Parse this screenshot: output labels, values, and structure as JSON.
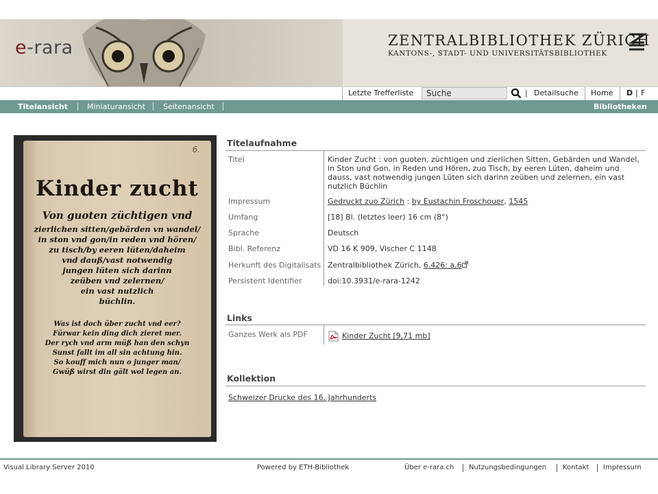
{
  "header": {
    "logo_prefix": "e",
    "logo_rest": "-rara",
    "library_name": "ZENTRALBIBLIOTHEK ZÜRICH",
    "library_subtitle": "KANTONS-, STADT- UND UNIVERSITÄTSBIBLIOTHEK"
  },
  "searchbar": {
    "last_results": "Letzte Trefferliste",
    "search_value": "Suche",
    "advanced": "Detailsuche",
    "home": "Home",
    "lang_de": "D",
    "lang_fr": "F",
    "sep": "|"
  },
  "nav": {
    "tabs": [
      "Titelansicht",
      "Miniaturansicht",
      "Seitenansicht"
    ],
    "right": "Bibliotheken"
  },
  "book": {
    "page_number": "6.",
    "title": "Kinder zucht",
    "lines": [
      "Von guoten züchtigen vnd",
      "zierlichen sitten/gebärden vn wandel/",
      "in ston vnd gon/in reden vnd hören/",
      "zu tisch/by eeren lüten/daheim",
      "vnd dauß/vast notwendig",
      "jungen lüten sich darinn",
      "zeüben vnd zelernen/",
      "ein vast nutzlich",
      "büchlin."
    ],
    "verse": [
      "Was ist doch über zucht vnd eer?",
      "Fürwar kein ding dich zieret mer.",
      "Der rych vnd arm müß han den schyn",
      "Sunst fallt im all sin achtung hin.",
      "So kouff mich nun o junger man/",
      "Gwüß wirst din gält wol legen an."
    ]
  },
  "titelaufnahme": {
    "heading": "Titelaufnahme",
    "rows": {
      "titel_label": "Titel",
      "titel_lines": [
        "Kinder Zucht : von guoten, züchtigen und zierlichen Sitten, Gebärden und Wandel,",
        "in Ston und Gon, in Reden und Hören, zuo Tisch, by eeren Lüten, daheim und",
        "dauss, vast notwendig jungen Lüten sich darinn zeüben und zelernen, ein vast",
        "nutzlich Büchlin"
      ],
      "impressum_label": "Impressum",
      "impressum_place": "Gedruckt zuo Zürich",
      "impressum_sep": " : ",
      "impressum_printer": "by Eustachin Froschouer",
      "impressum_comma": ", ",
      "impressum_year": "1545",
      "umfang_label": "Umfang",
      "umfang_value": "[18] Bl. (letztes leer) 16 cm (8°)",
      "sprache_label": "Sprache",
      "sprache_value": "Deutsch",
      "bibl_label": "Bibl. Referenz",
      "bibl_value": "VD 16 K 909, Vischer C 1148",
      "herkunft_label": "Herkunft des Digitalisats",
      "herkunft_value": "Zentralbibliothek Zürich, ",
      "herkunft_link": "6.426: a,6",
      "pid_label": "Persistent Identifier",
      "pid_value": "doi:10.3931/e-rara-1242"
    }
  },
  "links": {
    "heading": "Links",
    "label": "Ganzes Werk als PDF",
    "pdf_link": "Kinder Zucht [9,71 mb]"
  },
  "kollektion": {
    "heading": "Kollektion",
    "link": "Schweizer Drucke des 16. Jahrhunderts"
  },
  "footer": {
    "server": "Visual Library Server 2010",
    "powered": "Powered by ETH-Bibliothek",
    "links": [
      "Über e-rara.ch",
      "Nutzungsbedingungen",
      "Kontakt",
      "Impressum"
    ]
  },
  "colors": {
    "nav": "#6e9a92",
    "brand": "#7a1e1e"
  }
}
